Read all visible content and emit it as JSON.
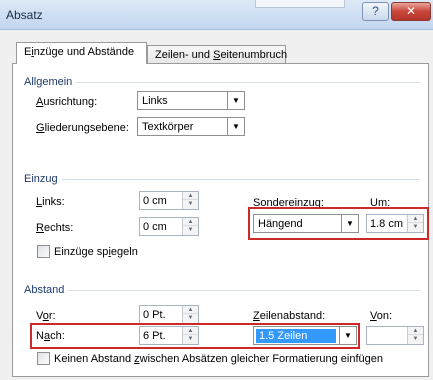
{
  "window": {
    "title": "Absatz",
    "help_label": "?",
    "close_label": "✕"
  },
  "tabs": {
    "active": {
      "pre": "E",
      "key": "i",
      "post": "nzüge und Abstände"
    },
    "inactive": {
      "pre": "Zeilen- und ",
      "key": "S",
      "post": "eitenumbruch"
    }
  },
  "allgemein": {
    "heading": "Allgemein",
    "ausrichtung": {
      "pre": "",
      "key": "A",
      "post": "usrichtung:",
      "value": "Links"
    },
    "gliederung": {
      "pre": "",
      "key": "G",
      "post": "liederungsebene:",
      "value": "Textkörper"
    }
  },
  "einzug": {
    "heading": "Einzug",
    "links": {
      "pre": "",
      "key": "L",
      "post": "inks:",
      "value": "0 cm"
    },
    "rechts": {
      "pre": "",
      "key": "R",
      "post": "echts:",
      "value": "0 cm"
    },
    "sondereinzug": {
      "pre": "Sondereinzu",
      "key": "g",
      "post": ":",
      "value": "Hängend"
    },
    "um": {
      "pre": "",
      "key": "U",
      "post": "m:",
      "value": "1.8 cm"
    },
    "spiegeln": {
      "pre": "Einzüge sp",
      "key": "i",
      "post": "egeln"
    }
  },
  "abstand": {
    "heading": "Abstand",
    "vor": {
      "pre": "V",
      "key": "o",
      "post": "r:",
      "value": "0 Pt."
    },
    "nach": {
      "pre": "N",
      "key": "a",
      "post": "ch:",
      "value": "6 Pt."
    },
    "zeilenabstand": {
      "pre": "",
      "key": "Z",
      "post": "eilenabstand:",
      "value": "1.5 Zeilen"
    },
    "von": {
      "pre": "",
      "key": "V",
      "post": "on:",
      "value": ""
    },
    "keinen": {
      "pre": "Keinen Abstand ",
      "key": "z",
      "post": "wischen Absätzen gleicher Formatierung einfügen"
    }
  },
  "icons": {
    "dropdown": "▼",
    "spin_up": "▲",
    "spin_down": "▼"
  },
  "colors": {
    "highlight": "#3399ff",
    "annotation_red": "#cc2a2a",
    "group_heading": "#1e3a6e"
  }
}
